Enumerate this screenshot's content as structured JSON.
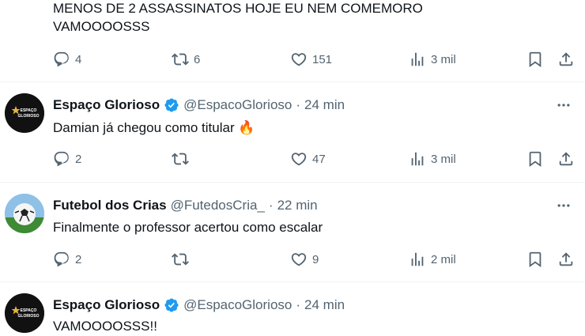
{
  "top_tweet": {
    "text_line1": "MENOS DE 2 ASSASSINATOS HOJE EU NEM COMEMORO",
    "text_line2": "VAMOOOOSSS",
    "replies": "4",
    "retweets": "6",
    "likes": "151",
    "views": "3 mil"
  },
  "tweets": [
    {
      "name": "Espaço Glorioso",
      "handle": "@EspacoGlorioso",
      "separator": "·",
      "time": "24 min",
      "text": "Damian já chegou como titular 🔥",
      "replies": "2",
      "retweets": "",
      "likes": "47",
      "views": "3 mil",
      "avatar_icon": "espaco-glorioso-logo"
    },
    {
      "name": "Futebol dos Crias",
      "handle": "@FutedosCria_",
      "separator": "·",
      "time": "22 min",
      "text": "Finalmente o professor acertou como escalar",
      "replies": "2",
      "retweets": "",
      "likes": "9",
      "views": "2 mil",
      "avatar_icon": "soccer-ball-avatar"
    },
    {
      "name": "Espaço Glorioso",
      "handle": "@EspacoGlorioso",
      "separator": "·",
      "time": "24 min",
      "text": "VAMOOOOSSS!!",
      "avatar_icon": "espaco-glorioso-logo"
    }
  ],
  "colors": {
    "text": "#0f1419",
    "secondary": "#536471",
    "verified": "#1d9bf0",
    "divider": "#eff3f4"
  },
  "logo_text": "ESPAÇO GLORIOSO"
}
